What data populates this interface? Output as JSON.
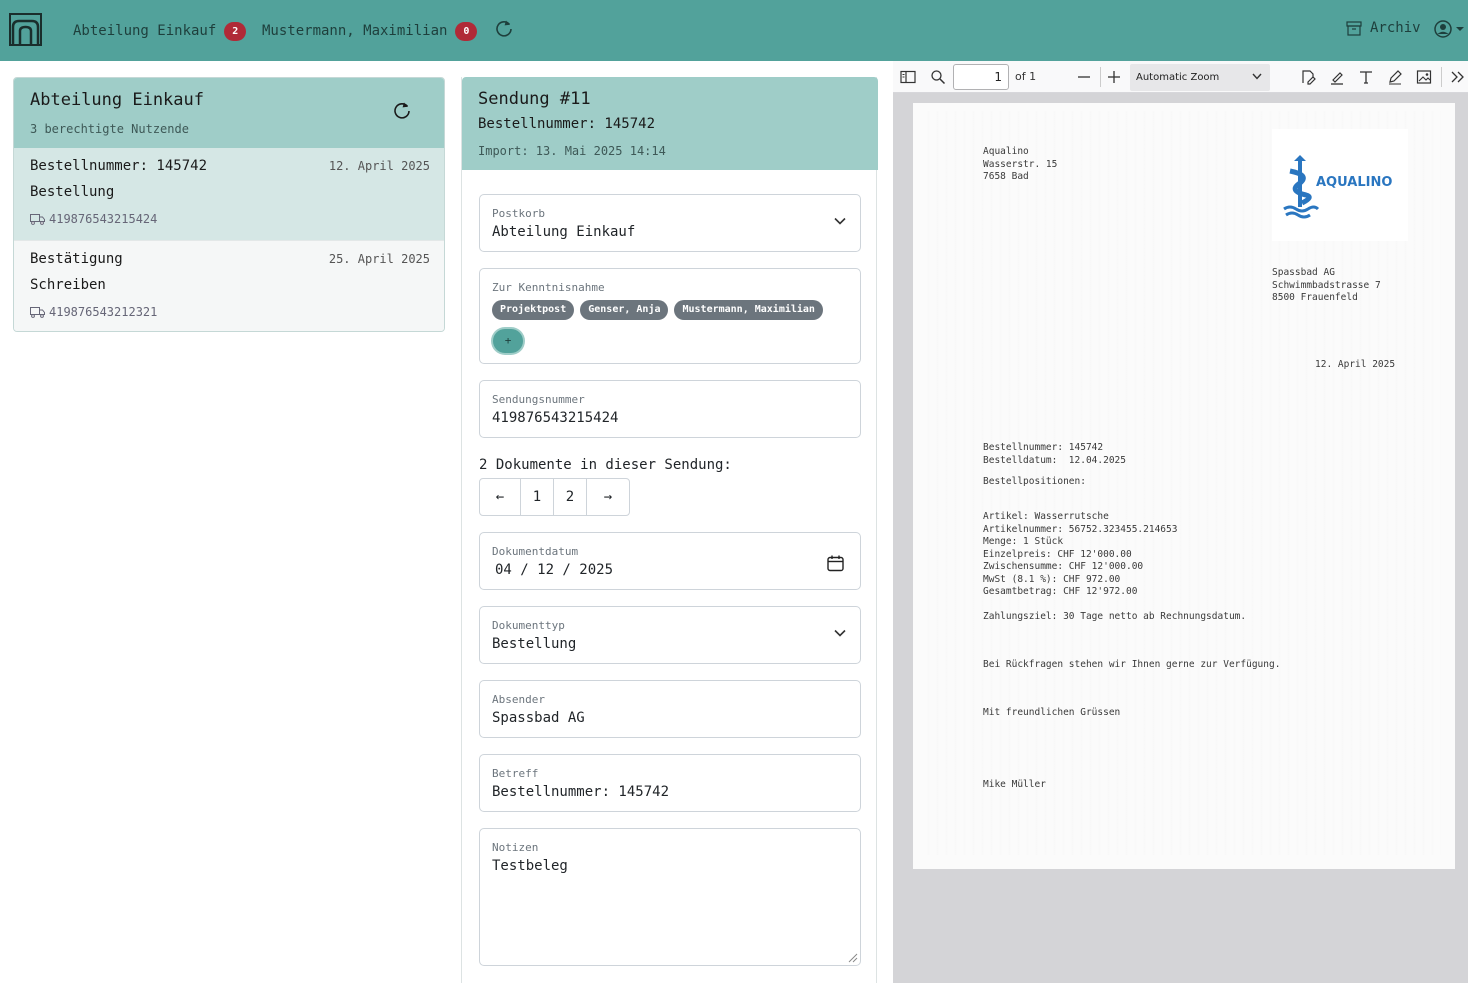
{
  "nav": {
    "items": [
      {
        "label": "Abteilung Einkauf",
        "badge": "2"
      },
      {
        "label": "Mustermann, Maximilian",
        "badge": "0"
      }
    ],
    "archiv_label": "Archiv"
  },
  "left": {
    "title": "Abteilung Einkauf",
    "subtitle": "3 berechtigte Nutzende",
    "rows": [
      {
        "title": "Bestellnummer: 145742",
        "date": "12. April 2025",
        "type": "Bestellung",
        "tracking": "419876543215424"
      },
      {
        "title": "Bestätigung",
        "date": "25. April 2025",
        "type": "Schreiben",
        "tracking": "419876543212321"
      }
    ]
  },
  "mid": {
    "title": "Sendung #11",
    "subtitle": "Bestellnummer: 145742",
    "import": "Import: 13. Mai 2025 14:14",
    "postkorb": {
      "label": "Postkorb",
      "value": "Abteilung Einkauf"
    },
    "kenntnis": {
      "label": "Zur Kenntnisnahme",
      "pills": [
        "Projektpost",
        "Genser, Anja",
        "Mustermann, Maximilian"
      ],
      "add": "+"
    },
    "sendungsnummer": {
      "label": "Sendungsnummer",
      "value": "419876543215424"
    },
    "docs_label": "2 Dokumente in dieser Sendung:",
    "pager": {
      "prev": "←",
      "pages": [
        "1",
        "2"
      ],
      "next": "→"
    },
    "dokumentdatum": {
      "label": "Dokumentdatum",
      "value": "04 / 12 / 2025"
    },
    "dokumenttyp": {
      "label": "Dokumenttyp",
      "value": "Bestellung"
    },
    "absender": {
      "label": "Absender",
      "value": "Spassbad AG"
    },
    "betreff": {
      "label": "Betreff",
      "value": "Bestellnummer: 145742"
    },
    "notizen": {
      "label": "Notizen",
      "value": "Testbeleg"
    }
  },
  "pdf": {
    "page_value": "1",
    "page_of": "of 1",
    "zoom": "Automatic Zoom",
    "sender": "Aqualino\nWasserstr. 15\n7658 Bad",
    "logo_text": "AQUALINO",
    "recipient": "Spassbad AG\nSchwimmbadstrasse 7\n8500 Frauenfeld",
    "date": "12. April 2025",
    "order": "Bestellnummer: 145742\nBestelldatum:  12.04.2025",
    "positions_header": "Bestellpositionen:",
    "positions": "Artikel: Wasserrutsche\nArtikelnummer: 56752.323455.214653\nMenge: 1 Stück\nEinzelpreis: CHF 12'000.00\nZwischensumme: CHF 12'000.00\nMwSt (8.1 %): CHF 972.00\nGesamtbetrag: CHF 12'972.00",
    "payment": "Zahlungsziel: 30 Tage netto ab Rechnungsdatum.",
    "questions": "Bei Rückfragen stehen wir Ihnen gerne zur Verfügung.",
    "greeting": "Mit freundlichen Grüssen",
    "signature": "Mike Müller"
  },
  "colors": {
    "nav": "#52a29b",
    "header": "#9fcdc8",
    "active_row": "#d5e7e5",
    "badge": "#b02a37"
  }
}
